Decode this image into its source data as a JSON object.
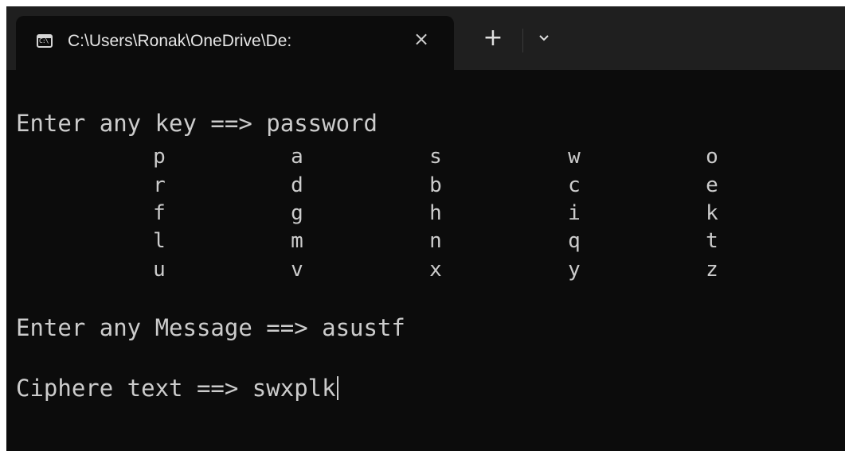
{
  "tab": {
    "title": "C:\\Users\\Ronak\\OneDrive\\De:",
    "close_icon": "×",
    "new_tab_icon": "+"
  },
  "terminal": {
    "key_prompt": "Enter any key ==> password",
    "matrix": [
      [
        "p",
        "a",
        "s",
        "w",
        "o"
      ],
      [
        "r",
        "d",
        "b",
        "c",
        "e"
      ],
      [
        "f",
        "g",
        "h",
        "i",
        "k"
      ],
      [
        "l",
        "m",
        "n",
        "q",
        "t"
      ],
      [
        "u",
        "v",
        "x",
        "y",
        "z"
      ]
    ],
    "message_prompt": "Enter any Message ==> asustf",
    "cipher_output": "Ciphere text ==> swxplk"
  }
}
